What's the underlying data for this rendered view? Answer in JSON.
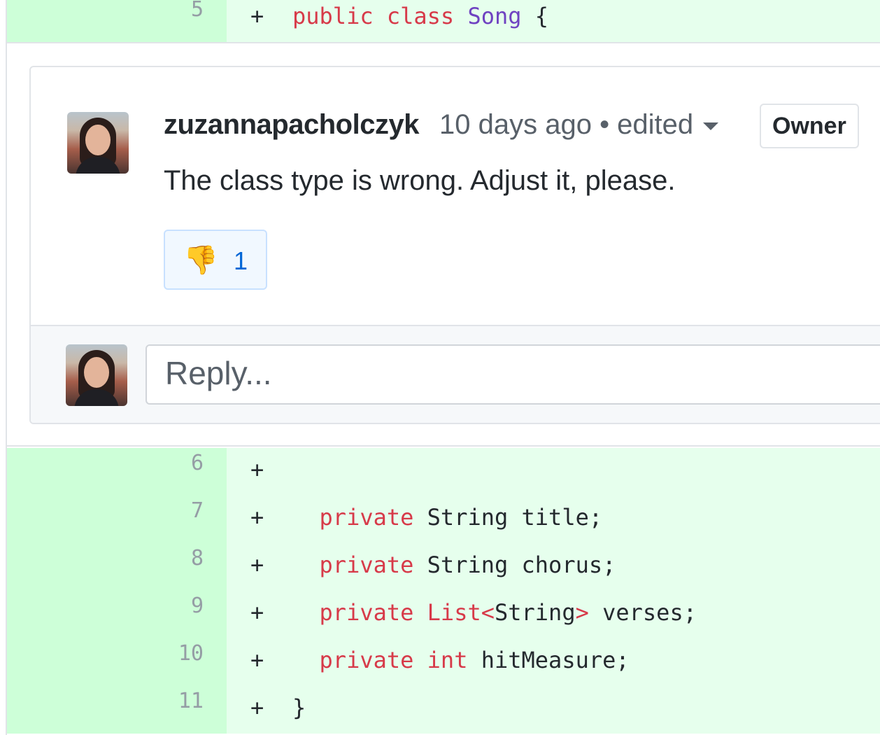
{
  "diff": {
    "lines_before": [
      {
        "num": "5",
        "marker": "+",
        "tokens": [
          {
            "t": "public",
            "c": "kw"
          },
          {
            "t": " "
          },
          {
            "t": "class",
            "c": "kw"
          },
          {
            "t": " "
          },
          {
            "t": "Song",
            "c": "cls"
          },
          {
            "t": " {"
          }
        ]
      }
    ],
    "lines_after": [
      {
        "num": "6",
        "marker": "+",
        "tokens": []
      },
      {
        "num": "7",
        "marker": "+",
        "tokens": [
          {
            "t": "  "
          },
          {
            "t": "private",
            "c": "kw"
          },
          {
            "t": " String title;"
          }
        ]
      },
      {
        "num": "8",
        "marker": "+",
        "tokens": [
          {
            "t": "  "
          },
          {
            "t": "private",
            "c": "kw"
          },
          {
            "t": " String chorus;"
          }
        ]
      },
      {
        "num": "9",
        "marker": "+",
        "tokens": [
          {
            "t": "  "
          },
          {
            "t": "private",
            "c": "kw"
          },
          {
            "t": " "
          },
          {
            "t": "List<",
            "c": "kw"
          },
          {
            "t": "String"
          },
          {
            "t": ">",
            "c": "kw"
          },
          {
            "t": " verses;"
          }
        ]
      },
      {
        "num": "10",
        "marker": "+",
        "tokens": [
          {
            "t": "  "
          },
          {
            "t": "private",
            "c": "kw"
          },
          {
            "t": " "
          },
          {
            "t": "int",
            "c": "kw"
          },
          {
            "t": " hitMeasure;"
          }
        ]
      },
      {
        "num": "11",
        "marker": "+",
        "tokens": [
          {
            "t": "}"
          }
        ]
      }
    ]
  },
  "comment": {
    "author": "zuzannapacholczyk",
    "meta": "10 days ago • edited",
    "badge": "Owner",
    "body": "The class type is wrong. Adjust it, please.",
    "reaction": {
      "emoji": "👎",
      "count": "1"
    },
    "reply_placeholder": "Reply..."
  },
  "colors": {
    "addition_bg": "#e6ffed",
    "addition_num_bg": "#cdffd8",
    "keyword": "#d73a49",
    "class_name": "#6f42c1",
    "link": "#0366d6"
  }
}
